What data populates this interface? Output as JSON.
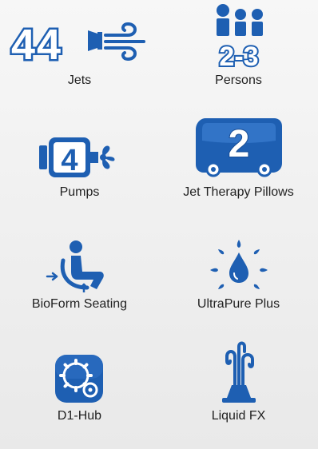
{
  "features": [
    {
      "label": "Jets",
      "icon": "jets-icon",
      "count": "44"
    },
    {
      "label": "Persons",
      "icon": "persons-icon",
      "count": "2-3"
    },
    {
      "label": "Pumps",
      "icon": "pumps-icon",
      "count": "4"
    },
    {
      "label": "Jet Therapy Pillows",
      "icon": "jet-therapy-pillows-icon",
      "count": "2"
    },
    {
      "label": "BioForm Seating",
      "icon": "bioform-seating-icon"
    },
    {
      "label": "UltraPure Plus",
      "icon": "ultrapure-plus-icon"
    },
    {
      "label": "D1-Hub",
      "icon": "d1-hub-icon"
    },
    {
      "label": "Liquid FX",
      "icon": "liquid-fx-icon"
    }
  ],
  "colors": {
    "brand_blue": "#1e5fb2",
    "dark_blue": "#174c95",
    "text": "#222222"
  }
}
